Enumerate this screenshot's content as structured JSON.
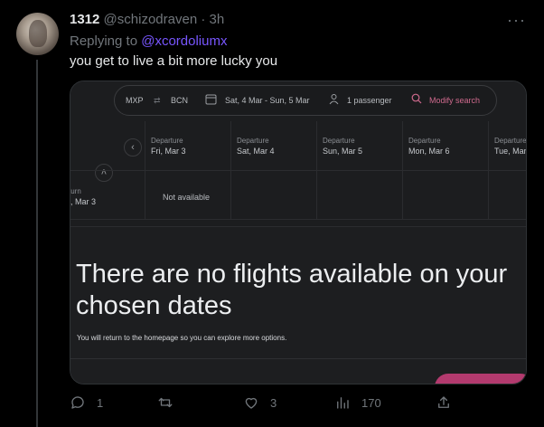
{
  "tweet": {
    "display_name": "1312",
    "handle": "@schizodraven",
    "separator": "·",
    "time": "3h",
    "more": "···",
    "replying_prefix": "Replying to",
    "replying_to": "@xcordoliumx",
    "text": "you get to live a bit more lucky you"
  },
  "media": {
    "search": {
      "from": "MXP",
      "swap": "⇄",
      "to": "BCN",
      "dates": "Sat, 4 Mar - Sun, 5 Mar",
      "passengers": "1 passenger",
      "modify": "Modify search"
    },
    "departure_label": "Departure",
    "dates": [
      "Fri, Mar 3",
      "Sat, Mar 4",
      "Sun, Mar 5",
      "Mon, Mar 6",
      "Tue, Mar"
    ],
    "return_label": "turn",
    "return_value": "i, Mar 3",
    "not_available": "Not available",
    "no_flights": "There are no flights available on your chosen dates",
    "explore": "You will return to the homepage so you can explore more options."
  },
  "actions": {
    "replies": "1",
    "retweets": "",
    "likes": "3",
    "views": "170"
  }
}
